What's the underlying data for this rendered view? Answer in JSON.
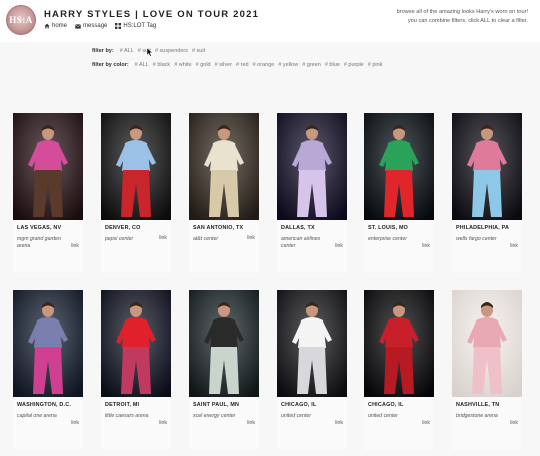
{
  "header": {
    "logo_text": "HS:A",
    "title": "HARRY STYLES | LOVE ON TOUR 2021",
    "nav": [
      {
        "label": "home",
        "icon": "home-icon"
      },
      {
        "label": "message",
        "icon": "mail-icon"
      },
      {
        "label": "HS:LOT Tag",
        "icon": "grid-icon"
      }
    ],
    "intro_line1": "browse all of the amazing looks Harry's worn on tour!",
    "intro_line2": "you can combine filters. click ALL to clear a filter."
  },
  "filters": {
    "type_label": "filter by:",
    "type_tags": [
      "# ALL",
      "# suit",
      "# suspenders",
      "# suit"
    ],
    "color_label": "filter by color:",
    "color_tags": [
      "# ALL",
      "# black",
      "# white",
      "# gold",
      "# silver",
      "# red",
      "# orange",
      "# yellow",
      "# green",
      "# blue",
      "# purple",
      "# pink"
    ]
  },
  "cards": [
    {
      "city": "LAS VEGAS, NV",
      "venue": "mgm grand garden arena",
      "link": "link",
      "colors": [
        "#2a1418",
        "#d44d9b",
        "#5a3a2a",
        "#1b0c10"
      ]
    },
    {
      "city": "DENVER, CO",
      "venue": "pepsi center",
      "link": "link",
      "colors": [
        "#181818",
        "#9bc2e6",
        "#c9252b",
        "#0c0c0c"
      ]
    },
    {
      "city": "SAN ANTONIO, TX",
      "venue": "at&t center",
      "link": "link",
      "colors": [
        "#3a3026",
        "#e9e2cf",
        "#d8caa8",
        "#221a14"
      ]
    },
    {
      "city": "DALLAS, TX",
      "venue": "american airlines center",
      "link": "link",
      "colors": [
        "#1a1230",
        "#b9a7d6",
        "#d6c4ea",
        "#0b0a1a"
      ]
    },
    {
      "city": "ST. LOUIS, MO",
      "venue": "enterprise center",
      "link": "link",
      "colors": [
        "#081016",
        "#2aa35a",
        "#e0262a",
        "#060a0e"
      ]
    },
    {
      "city": "PHILADELPHIA, PA",
      "venue": "wells fargo center",
      "link": "link",
      "colors": [
        "#101018",
        "#e07a9a",
        "#8ec8e8",
        "#0a0a10"
      ]
    },
    {
      "city": "WASHINGTON, D.C.",
      "venue": "capital one arena",
      "link": "link",
      "colors": [
        "#1a2436",
        "#7b7fb0",
        "#d04090",
        "#0e1420"
      ]
    },
    {
      "city": "DETROIT, MI",
      "venue": "little caesars arena",
      "link": "link",
      "colors": [
        "#161a2a",
        "#e0202a",
        "#c03a60",
        "#0a0c16"
      ]
    },
    {
      "city": "SAINT PAUL, MN",
      "venue": "xcel energy center",
      "link": "link",
      "colors": [
        "#1e2a2e",
        "#2a2a2a",
        "#c8d4cc",
        "#101618"
      ]
    },
    {
      "city": "CHICAGO, IL",
      "venue": "united center",
      "link": "link",
      "colors": [
        "#1a1a1e",
        "#f4f4f4",
        "#d8d8dc",
        "#0c0c10"
      ]
    },
    {
      "city": "CHICAGO, IL",
      "venue": "united center",
      "link": "link",
      "colors": [
        "#0a0a0c",
        "#c8202a",
        "#b81a24",
        "#060608"
      ]
    },
    {
      "city": "NASHVILLE, TN",
      "venue": "bridgestone arena",
      "link": "link",
      "colors": [
        "#f2eeea",
        "#e8a8b4",
        "#f0c0c8",
        "#d8d0cc"
      ]
    }
  ]
}
